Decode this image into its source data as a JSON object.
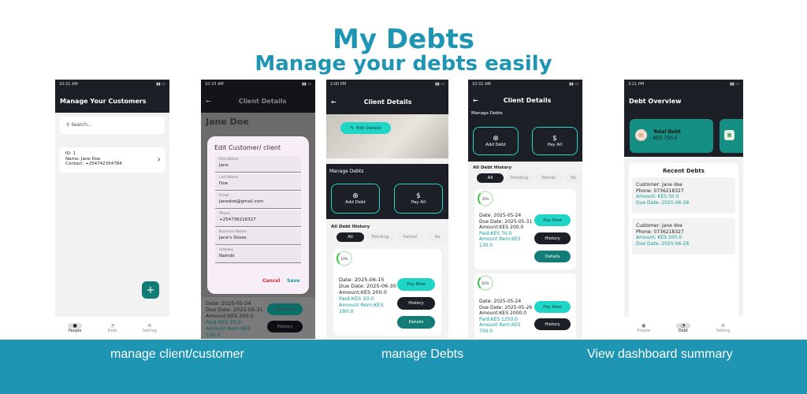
{
  "header": {
    "title": "My Debts",
    "subtitle": "Manage your debts easily"
  },
  "captions": [
    "manage client/customer",
    "manage Debts",
    "View dashboard summary"
  ],
  "p1": {
    "time": "10:31 AM",
    "title": "Manage Your Customers",
    "search": "Search...",
    "item": {
      "id": "ID: 1",
      "name": "Name: Jane Doe",
      "contact": "Contact: +254742354784"
    },
    "fab": "+",
    "nav": [
      "People",
      "Debt",
      "Setting"
    ]
  },
  "p2": {
    "time": "10:33 AM",
    "title": "Client Details",
    "name": "Jane Doe",
    "dialog_title": "Edit Customer/ client",
    "fields": [
      {
        "l": "First Name",
        "v": "Jane"
      },
      {
        "l": "Last Name",
        "v": "Doe"
      },
      {
        "l": "Email",
        "v": "janedoe@gmail.com"
      },
      {
        "l": "Phone",
        "v": "+254736218327"
      },
      {
        "l": "Business Name",
        "v": "Jane's Shoes"
      },
      {
        "l": "Address",
        "v": "Nairobi"
      }
    ],
    "cancel": "Cancel",
    "save": "Save",
    "behind": {
      "date": "Date: 2025-05-24",
      "due": "Due Date: 2025-05-31",
      "amount": "Amount:KES 200.0",
      "paid": "Paid:KES 70.0",
      "rem1": "Amount Rem:KES",
      "rem2": "130.0",
      "pay": "Pay Now",
      "history": "History"
    }
  },
  "p3": {
    "time": "2:00 PM",
    "title": "Client Details",
    "edit": "Edit Details",
    "manage": "Manage Debts",
    "add": "Add Debt",
    "payall": "Pay All",
    "hist": "All Debt History",
    "chips": [
      "All",
      "Pending",
      "Partial",
      "Pa"
    ],
    "ring": "10%",
    "date": "Date: 2025-06-15",
    "due": "Due Date: 2025-06-30",
    "amount": "Amount:KES 200.0",
    "paid": "Paid:KES 20.0",
    "rem1": "Amount Rem:KES",
    "rem2": "180.0",
    "pay": "Pay Now",
    "history": "History",
    "details": "Details"
  },
  "p4": {
    "time": "10:32 AM",
    "title": "Client Details",
    "manage": "Manage Debts",
    "add": "Add Debt",
    "payall": "Pay All",
    "hist": "All Debt History",
    "chips": [
      "All",
      "Pending",
      "Partial",
      "Pa"
    ],
    "r1": {
      "ring": "35%",
      "date": "Date: 2025-05-24",
      "due": "Due Date: 2025-05-31",
      "amount": "Amount:KES 200.0",
      "paid": "Paid:KES 70.0",
      "rem1": "Amount Rem:KES",
      "rem2": "130.0"
    },
    "r2": {
      "ring": "62%",
      "date": "Date: 2025-05-24",
      "due": "Due Date: 2025-05-26",
      "amount": "Amount:KES 2000.0",
      "paid": "Paid:KES 1250.0",
      "rem1": "Amount Rem:KES",
      "rem2": "750.0"
    },
    "pay": "Pay Now",
    "history": "History",
    "details": "Details"
  },
  "p5": {
    "time": "3:21 PM",
    "title": "Debt Overview",
    "total_label": "Total Debt",
    "total_value": "KES 750.0",
    "recent": "Recent Debts",
    "d1": {
      "c": "Customer: Jane doe",
      "p": "Phone: 0736218327",
      "a": "Amount: KES 50.0",
      "d": "Due Date: 2025-06-28"
    },
    "d2": {
      "c": "Customer: Jane doe",
      "p": "Phone: 0736218327",
      "a": "Amount: KES 200.0",
      "d": "Due Date: 2025-06-28"
    },
    "nav": [
      "People",
      "Debt",
      "Setting"
    ]
  },
  "colors": {
    "brand": "#1e95b3",
    "teal": "#1fd5c5",
    "dark": "#1c1f26",
    "dteal": "#127c76"
  }
}
